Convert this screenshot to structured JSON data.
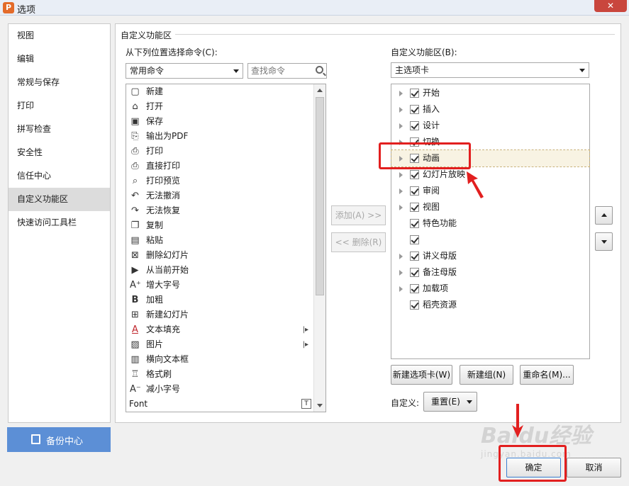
{
  "window": {
    "title": "选项",
    "close": "✕"
  },
  "nav": {
    "items": [
      "视图",
      "编辑",
      "常规与保存",
      "打印",
      "拼写检查",
      "安全性",
      "信任中心",
      "自定义功能区",
      "快速访问工具栏"
    ],
    "active_index": 7
  },
  "backup": {
    "label": "备份中心"
  },
  "main": {
    "group_title": "自定义功能区",
    "choose_label": "从下列位置选择命令(C):",
    "choose_value": "常用命令",
    "search_placeholder": "查找命令",
    "customize_label": "自定义功能区(B):",
    "customize_value": "主选项卡",
    "add_button": "添加(A) >>",
    "remove_button": "<< 删除(R)",
    "new_tab_button": "新建选项卡(W)",
    "new_group_button": "新建组(N)",
    "rename_button": "重命名(M)...",
    "custom_label": "自定义:",
    "reset_button": "重置(E)"
  },
  "commands": [
    {
      "label": "新建",
      "icon": "new-doc-icon",
      "glyph": "▢"
    },
    {
      "label": "打开",
      "icon": "open-folder-icon",
      "glyph": "⌂"
    },
    {
      "label": "保存",
      "icon": "save-icon",
      "glyph": "▣"
    },
    {
      "label": "输出为PDF",
      "icon": "pdf-export-icon",
      "glyph": "⎘"
    },
    {
      "label": "打印",
      "icon": "print-icon",
      "glyph": "⎙"
    },
    {
      "label": "直接打印",
      "icon": "direct-print-icon",
      "glyph": "⎙"
    },
    {
      "label": "打印预览",
      "icon": "print-preview-icon",
      "glyph": "⌕"
    },
    {
      "label": "无法撤消",
      "icon": "undo-icon",
      "glyph": "↶"
    },
    {
      "label": "无法恢复",
      "icon": "redo-icon",
      "glyph": "↷"
    },
    {
      "label": "复制",
      "icon": "copy-icon",
      "glyph": "❐"
    },
    {
      "label": "粘贴",
      "icon": "paste-icon",
      "glyph": "▤"
    },
    {
      "label": "删除幻灯片",
      "icon": "delete-slide-icon",
      "glyph": "⊠"
    },
    {
      "label": "从当前开始",
      "icon": "play-from-current-icon",
      "glyph": "▶"
    },
    {
      "label": "增大字号",
      "icon": "increase-font-icon",
      "glyph": "A⁺"
    },
    {
      "label": "加粗",
      "icon": "bold-icon",
      "glyph": "B"
    },
    {
      "label": "新建幻灯片",
      "icon": "new-slide-icon",
      "glyph": "⊞"
    },
    {
      "label": "文本填充",
      "icon": "text-fill-icon",
      "glyph": "A",
      "submenu": true
    },
    {
      "label": "图片",
      "icon": "picture-icon",
      "glyph": "▨",
      "submenu": true
    },
    {
      "label": "横向文本框",
      "icon": "textbox-icon",
      "glyph": "▥"
    },
    {
      "label": "格式刷",
      "icon": "format-painter-icon",
      "glyph": "♖"
    },
    {
      "label": "减小字号",
      "icon": "decrease-font-icon",
      "glyph": "A⁻"
    },
    {
      "label": "Font",
      "icon": "",
      "glyph": "",
      "font_box": true
    }
  ],
  "tabs": [
    {
      "label": "开始",
      "expandable": true
    },
    {
      "label": "插入",
      "expandable": true
    },
    {
      "label": "设计",
      "expandable": true
    },
    {
      "label": "切换",
      "expandable": true
    },
    {
      "label": "动画",
      "expandable": true,
      "selected": true
    },
    {
      "label": "幻灯片放映",
      "expandable": true
    },
    {
      "label": "审阅",
      "expandable": true
    },
    {
      "label": "视图",
      "expandable": true
    },
    {
      "label": "特色功能",
      "expandable": false
    },
    {
      "label": "",
      "expandable": false
    },
    {
      "label": "讲义母版",
      "expandable": true
    },
    {
      "label": "备注母版",
      "expandable": true
    },
    {
      "label": "加载项",
      "expandable": true
    },
    {
      "label": "稻壳资源",
      "expandable": false
    }
  ],
  "footer": {
    "ok": "确定",
    "cancel": "取消"
  },
  "watermark": {
    "logo": "Baidu经验",
    "sub": "jingyan.baidu.com"
  },
  "colors": {
    "accent": "#5c8fd6",
    "highlight": "#e21f1f"
  }
}
